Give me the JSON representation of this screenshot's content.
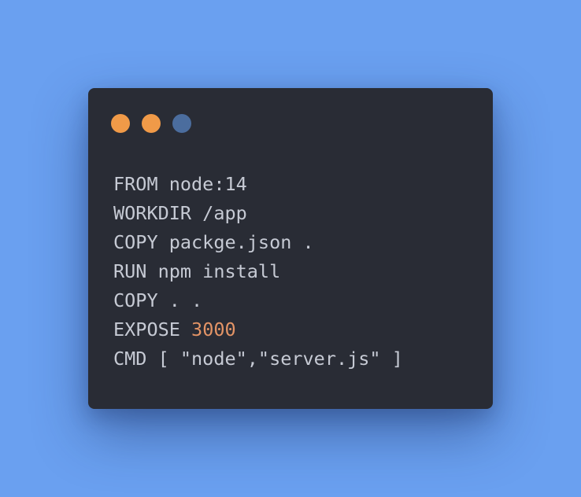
{
  "window": {
    "controls": [
      {
        "name": "close-dot",
        "color": "#f09a48"
      },
      {
        "name": "minimize-dot",
        "color": "#f09a48"
      },
      {
        "name": "maximize-dot",
        "color": "#4b6d9e"
      }
    ]
  },
  "code": {
    "lines": [
      {
        "text": "FROM node:14"
      },
      {
        "text": "WORKDIR /app"
      },
      {
        "text": "COPY packge.json ."
      },
      {
        "text": "RUN npm install"
      },
      {
        "text": "COPY . ."
      },
      {
        "text": "EXPOSE ",
        "number": "3000"
      },
      {
        "text": "CMD [ \"node\",\"server.js\" ]"
      }
    ]
  },
  "colors": {
    "background": "#6aa0f0",
    "window": "#292c35",
    "text": "#c6cad4",
    "number": "#e39466"
  }
}
